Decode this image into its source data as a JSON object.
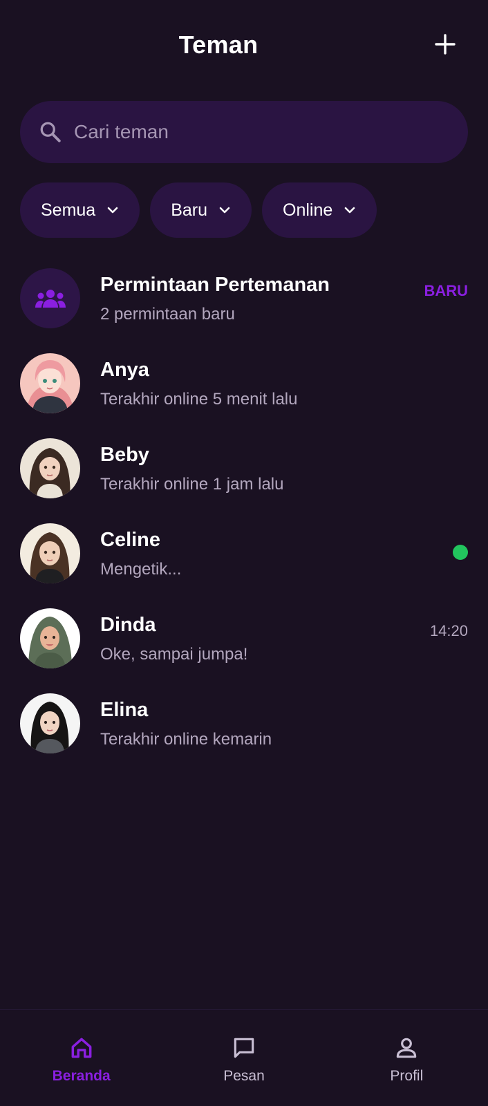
{
  "header": {
    "title": "Teman",
    "add_icon": "plus-icon"
  },
  "search": {
    "placeholder": "Cari teman",
    "icon": "search-icon"
  },
  "filters": [
    {
      "label": "Semua"
    },
    {
      "label": "Baru"
    },
    {
      "label": "Online"
    }
  ],
  "friend_request": {
    "title": "Permintaan Pertemanan",
    "subtitle": "2 permintaan baru",
    "badge": "BARU",
    "icon": "group-icon"
  },
  "friends": [
    {
      "name": "Anya",
      "status": "Terakhir online 5 menit lalu"
    },
    {
      "name": "Beby",
      "status": "Terakhir online 1 jam lalu"
    },
    {
      "name": "Celine",
      "status": "Mengetik...",
      "online": true
    },
    {
      "name": "Dinda",
      "status": "Oke, sampai jumpa!",
      "time": "14:20"
    },
    {
      "name": "Elina",
      "status": "Terakhir online kemarin"
    }
  ],
  "bottom_nav": [
    {
      "label": "Beranda",
      "icon": "home-icon",
      "active": true
    },
    {
      "label": "Pesan",
      "icon": "chat-icon"
    },
    {
      "label": "Profil",
      "icon": "person-icon"
    }
  ],
  "colors": {
    "background": "#1a1122",
    "surface": "#2a1442",
    "accent": "#8a1fe0",
    "online": "#22c55e",
    "muted_text": "#b3a7be"
  }
}
